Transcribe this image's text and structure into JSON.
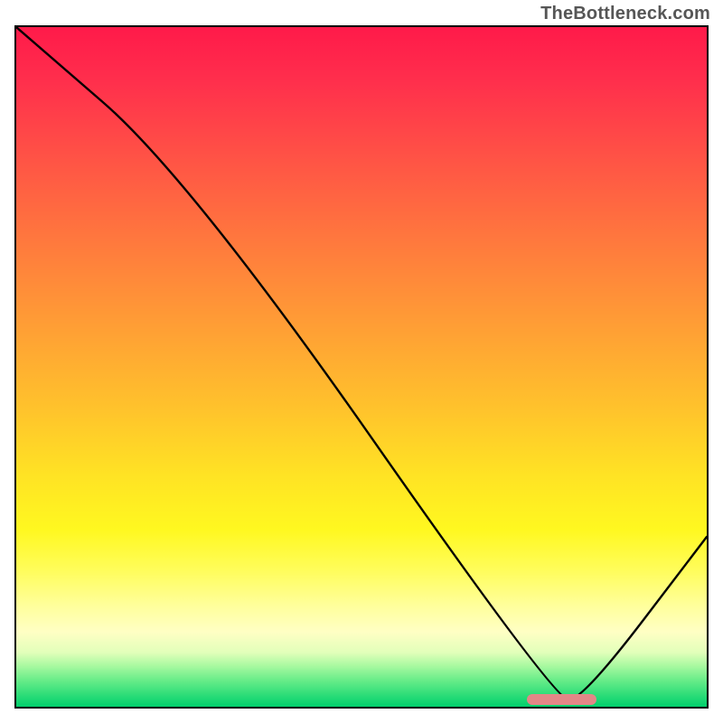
{
  "attribution": "TheBottleneck.com",
  "chart_data": {
    "type": "line",
    "title": "",
    "xlabel": "",
    "ylabel": "",
    "xlim": [
      0,
      100
    ],
    "ylim": [
      0,
      100
    ],
    "series": [
      {
        "name": "bottleneck-curve",
        "x": [
          0,
          25,
          78,
          82,
          100
        ],
        "values": [
          100,
          78,
          1,
          1,
          25
        ]
      }
    ],
    "marker": {
      "name": "optimal-range",
      "x_start": 74,
      "x_end": 84,
      "y": 1
    },
    "background_gradient": {
      "top": "#ff1a4a",
      "mid": "#ffe324",
      "bottom": "#00cf6c"
    }
  }
}
